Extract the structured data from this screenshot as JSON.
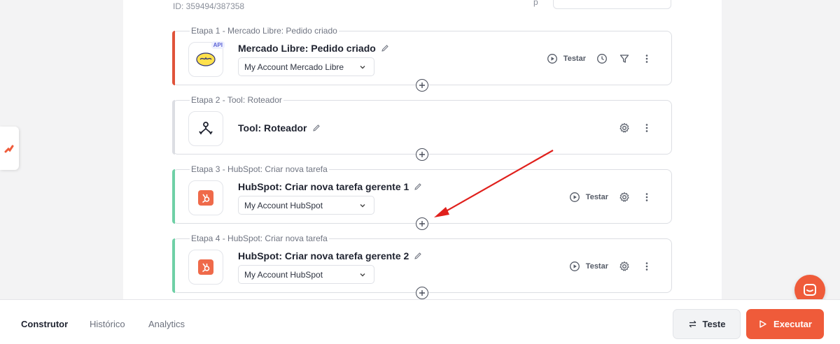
{
  "workflow": {
    "id_text": "ID: 359494/387358",
    "top_label_fragment": "p"
  },
  "steps": [
    {
      "label": "Etapa 1 - Mercado Libre: Pedido criado",
      "title": "Mercado Libre: Pedido criado",
      "account": "My Account Mercado Libre",
      "badge": "API",
      "accent_color": "#e0533a",
      "actions": [
        "play-circle-icon",
        "clock-icon",
        "filter-icon",
        "more-vertical-icon"
      ],
      "test_label": "Testar"
    },
    {
      "label": "Etapa 2 - Tool: Roteador",
      "title": "Tool: Roteador",
      "accent_color": "#dcdee3",
      "actions": [
        "gear-icon",
        "more-vertical-icon"
      ]
    },
    {
      "label": "Etapa 3 - HubSpot: Criar nova tarefa",
      "title": "HubSpot: Criar nova tarefa gerente 1",
      "account": "My Account HubSpot",
      "accent_color": "#6fd0a6",
      "actions": [
        "play-circle-icon",
        "gear-icon",
        "more-vertical-icon"
      ],
      "test_label": "Testar"
    },
    {
      "label": "Etapa 4 - HubSpot: Criar nova tarefa",
      "title": "HubSpot: Criar nova tarefa gerente 2",
      "account": "My Account HubSpot",
      "accent_color": "#6fd0a6",
      "actions": [
        "play-circle-icon",
        "gear-icon",
        "more-vertical-icon"
      ],
      "test_label": "Testar"
    }
  ],
  "bottom_nav": {
    "tabs": [
      {
        "label": "Construtor",
        "active": true
      },
      {
        "label": "Histórico",
        "active": false
      },
      {
        "label": "Analytics",
        "active": false
      }
    ],
    "test_button": "Teste",
    "run_button": "Executar"
  },
  "colors": {
    "brand": "#ef5b3a",
    "hubspot": "#ef6a4a",
    "annotation_arrow": "#e0201c"
  }
}
